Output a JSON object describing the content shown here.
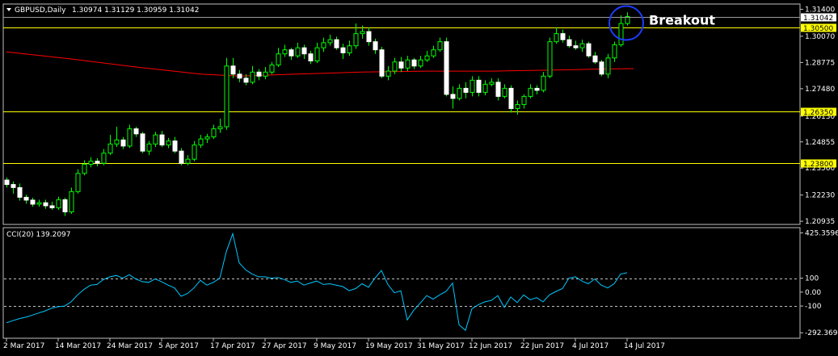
{
  "chart_data": {
    "type": "candlestick",
    "header": {
      "symbol": "GBPUSD,Daily",
      "ohlc": "1.30974 1.31129 1.30959 1.31042"
    },
    "price_axis": {
      "ticks": [
        "1.31400",
        "1.30070",
        "1.28775",
        "1.27480",
        "1.26130",
        "1.24855",
        "1.23560",
        "1.22230",
        "1.20935"
      ],
      "tick_values": [
        1.314,
        1.3007,
        1.28775,
        1.2748,
        1.2613,
        1.24855,
        1.2356,
        1.2223,
        1.20935
      ],
      "ylim": [
        1.2082,
        1.3162
      ]
    },
    "current_price": {
      "label": "1.31042",
      "value": 1.31042
    },
    "levels": [
      {
        "label": "1.30500",
        "value": 1.305,
        "color": "#ffff00"
      },
      {
        "label": "1.26350",
        "value": 1.2635,
        "color": "#ffff00"
      },
      {
        "label": "1.23800",
        "value": 1.238,
        "color": "#ffff00"
      }
    ],
    "annotation": {
      "text": "Breakout"
    },
    "date_labels": [
      "2 Mar 2017",
      "14 Mar 2017",
      "24 Mar 2017",
      "5 Apr 2017",
      "17 Apr 2017",
      "27 Apr 2017",
      "9 May 2017",
      "19 May 2017",
      "31 May 2017",
      "12 Jun 2017",
      "22 Jun 2017",
      "4 Jul 2017",
      "14 Jul 2017"
    ],
    "date_label_bar_index": [
      0,
      8,
      16,
      24,
      32,
      40,
      48,
      56,
      64,
      72,
      80,
      88,
      96
    ],
    "candles": {
      "open": [
        1.2297,
        1.2275,
        1.226,
        1.2212,
        1.2198,
        1.2178,
        1.2185,
        1.217,
        1.216,
        1.22,
        1.214,
        1.224,
        1.233,
        1.2375,
        1.239,
        1.238,
        1.243,
        1.2475,
        1.2495,
        1.2465,
        1.255,
        1.2525,
        1.244,
        1.2475,
        1.252,
        1.247,
        1.249,
        1.244,
        1.238,
        1.24,
        1.247,
        1.25,
        1.251,
        1.255,
        1.256,
        1.286,
        1.282,
        1.28,
        1.278,
        1.283,
        1.281,
        1.283,
        1.2865,
        1.292,
        1.294,
        1.291,
        1.295,
        1.292,
        1.2885,
        1.295,
        1.2975,
        1.299,
        1.295,
        1.2925,
        1.296,
        1.302,
        1.303,
        1.298,
        1.294,
        1.281,
        1.2835,
        1.288,
        1.285,
        1.289,
        1.286,
        1.289,
        1.291,
        1.294,
        1.298,
        1.272,
        1.27,
        1.275,
        1.273,
        1.279,
        1.273,
        1.277,
        1.278,
        1.271,
        1.275,
        1.265,
        1.267,
        1.271,
        1.275,
        1.274,
        1.281,
        1.298,
        1.302,
        1.299,
        1.296,
        1.295,
        1.297,
        1.291,
        1.288,
        1.282,
        1.29,
        1.2965,
        1.307
      ],
      "close": [
        1.2275,
        1.226,
        1.2212,
        1.2198,
        1.2178,
        1.2185,
        1.217,
        1.216,
        1.22,
        1.214,
        1.224,
        1.233,
        1.2375,
        1.239,
        1.238,
        1.243,
        1.2475,
        1.2495,
        1.2465,
        1.255,
        1.2525,
        1.244,
        1.2475,
        1.252,
        1.247,
        1.249,
        1.244,
        1.238,
        1.24,
        1.247,
        1.25,
        1.251,
        1.255,
        1.256,
        1.286,
        1.282,
        1.28,
        1.278,
        1.283,
        1.281,
        1.283,
        1.2865,
        1.292,
        1.294,
        1.291,
        1.295,
        1.292,
        1.2885,
        1.295,
        1.2975,
        1.299,
        1.295,
        1.2925,
        1.296,
        1.302,
        1.303,
        1.298,
        1.294,
        1.281,
        1.2835,
        1.288,
        1.285,
        1.289,
        1.286,
        1.289,
        1.291,
        1.294,
        1.298,
        1.272,
        1.27,
        1.275,
        1.273,
        1.279,
        1.273,
        1.277,
        1.278,
        1.271,
        1.275,
        1.265,
        1.267,
        1.271,
        1.275,
        1.274,
        1.281,
        1.298,
        1.302,
        1.299,
        1.296,
        1.295,
        1.297,
        1.291,
        1.288,
        1.282,
        1.29,
        1.2965,
        1.307,
        1.3104
      ],
      "high": [
        1.231,
        1.229,
        1.228,
        1.2225,
        1.221,
        1.22,
        1.22,
        1.219,
        1.2215,
        1.221,
        1.226,
        1.235,
        1.2395,
        1.241,
        1.2405,
        1.245,
        1.252,
        1.256,
        1.251,
        1.257,
        1.256,
        1.2535,
        1.249,
        1.2535,
        1.254,
        1.2505,
        1.251,
        1.2455,
        1.242,
        1.249,
        1.252,
        1.2525,
        1.257,
        1.26,
        1.29,
        1.29,
        1.284,
        1.282,
        1.286,
        1.2845,
        1.2855,
        1.288,
        1.295,
        1.2965,
        1.295,
        1.2975,
        1.2965,
        1.2935,
        1.2975,
        1.3,
        1.3015,
        1.3005,
        1.297,
        1.2985,
        1.307,
        1.306,
        1.305,
        1.2995,
        1.2955,
        1.286,
        1.29,
        1.2905,
        1.291,
        1.29,
        1.291,
        1.2935,
        1.296,
        1.3,
        1.3,
        1.276,
        1.277,
        1.278,
        1.281,
        1.281,
        1.279,
        1.28,
        1.28,
        1.277,
        1.2765,
        1.269,
        1.272,
        1.277,
        1.2765,
        1.283,
        1.3,
        1.305,
        1.304,
        1.301,
        1.2985,
        1.299,
        1.298,
        1.293,
        1.289,
        1.292,
        1.298,
        1.311,
        1.3125
      ],
      "low": [
        1.226,
        1.223,
        1.2195,
        1.218,
        1.2165,
        1.2165,
        1.2155,
        1.215,
        1.215,
        1.212,
        1.213,
        1.223,
        1.232,
        1.236,
        1.2365,
        1.237,
        1.242,
        1.246,
        1.245,
        1.2455,
        1.251,
        1.243,
        1.242,
        1.246,
        1.246,
        1.2455,
        1.243,
        1.237,
        1.237,
        1.239,
        1.2455,
        1.248,
        1.25,
        1.253,
        1.2545,
        1.28,
        1.278,
        1.2765,
        1.277,
        1.279,
        1.2795,
        1.282,
        1.2855,
        1.2905,
        1.289,
        1.29,
        1.2895,
        1.287,
        1.2875,
        1.293,
        1.296,
        1.294,
        1.2895,
        1.291,
        1.2945,
        1.2995,
        1.296,
        1.292,
        1.28,
        1.279,
        1.282,
        1.283,
        1.2835,
        1.2845,
        1.285,
        1.288,
        1.29,
        1.293,
        1.271,
        1.265,
        1.269,
        1.27,
        1.271,
        1.271,
        1.2715,
        1.276,
        1.269,
        1.27,
        1.263,
        1.262,
        1.265,
        1.27,
        1.272,
        1.273,
        1.28,
        1.297,
        1.2975,
        1.295,
        1.294,
        1.293,
        1.29,
        1.287,
        1.281,
        1.28,
        1.288,
        1.2955,
        1.306
      ]
    },
    "moving_average": {
      "color": "#ff0000",
      "points": [
        [
          0,
          1.293
        ],
        [
          10,
          1.2895
        ],
        [
          20,
          1.2855
        ],
        [
          30,
          1.282
        ],
        [
          36,
          1.281
        ],
        [
          45,
          1.282
        ],
        [
          55,
          1.283
        ],
        [
          65,
          1.2835
        ],
        [
          75,
          1.2835
        ],
        [
          85,
          1.284
        ],
        [
          92,
          1.2845
        ],
        [
          97,
          1.2847
        ]
      ]
    },
    "cci": {
      "label": "CCI(20) 139.2097",
      "color": "#00c8ff",
      "ticks": [
        "425.3596",
        "100",
        "0.00",
        "-100",
        "-292.3692"
      ],
      "tick_values": [
        425.3596,
        100,
        0,
        -100,
        -292.3692
      ],
      "ylim": [
        -320,
        440
      ],
      "dashed_levels": [
        100,
        -100
      ],
      "values": [
        -220,
        -205,
        -190,
        -180,
        -165,
        -150,
        -135,
        -115,
        -105,
        -100,
        -70,
        -20,
        20,
        50,
        55,
        90,
        110,
        120,
        100,
        125,
        95,
        75,
        70,
        95,
        75,
        50,
        30,
        -30,
        -10,
        30,
        85,
        50,
        70,
        100,
        290,
        420,
        210,
        160,
        130,
        110,
        110,
        100,
        105,
        90,
        70,
        80,
        50,
        65,
        80,
        55,
        60,
        50,
        40,
        10,
        25,
        60,
        35,
        100,
        155,
        55,
        -5,
        10,
        -200,
        -130,
        -80,
        -25,
        -50,
        -20,
        5,
        65,
        -235,
        -275,
        -120,
        -90,
        -70,
        -60,
        -25,
        -110,
        -35,
        -75,
        -20,
        -55,
        -40,
        -70,
        -20,
        5,
        25,
        100,
        110,
        80,
        60,
        95,
        50,
        30,
        60,
        130,
        139
      ]
    }
  }
}
